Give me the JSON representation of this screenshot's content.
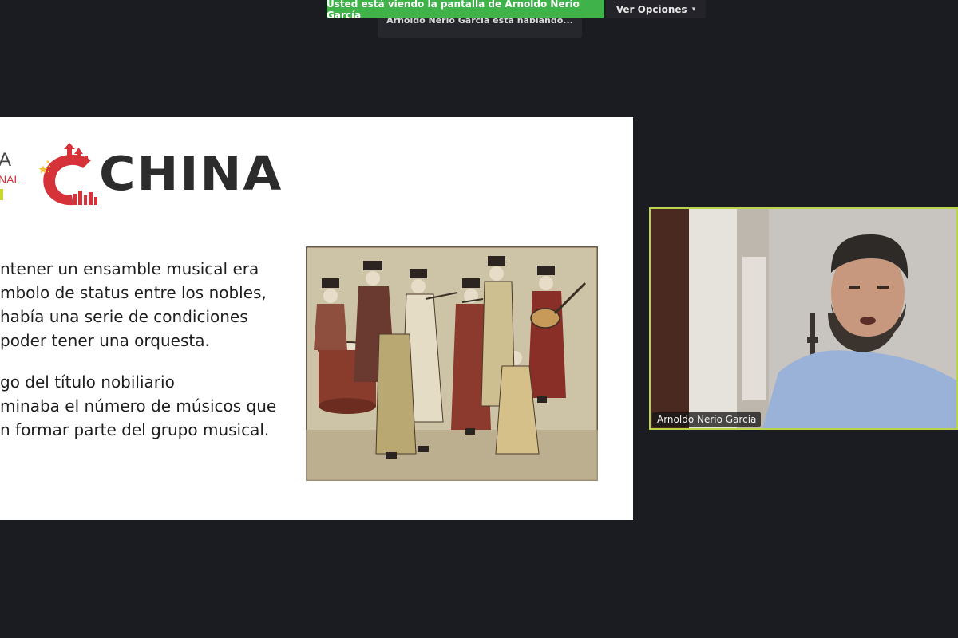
{
  "meeting": {
    "share_banner": "Usted está viendo la pantalla de Arnoldo Nerio García",
    "view_options_label": "Ver Opciones",
    "speaking_status": "Arnoldo Nerio García está hablando..."
  },
  "slide": {
    "brand_left_a": "A",
    "brand_left_nal": "NAL",
    "logo_word": "CHINA",
    "paragraphs": [
      {
        "lines": [
          "ntener un ensamble musical era",
          "mbolo de status entre los nobles,",
          "había una serie de condiciones",
          "poder tener una orquesta."
        ]
      },
      {
        "lines": [
          "go del título nobiliario",
          "minaba el número de músicos que",
          "n formar parte del grupo musical."
        ]
      }
    ],
    "painting_icon": "musicians-painting-image"
  },
  "video": {
    "participant_name": "Arnoldo Nerio García",
    "active_speaker_color": "#b9d34a"
  },
  "colors": {
    "banner_green": "#3fb24a",
    "background": "#1b1c22",
    "logo_red": "#d6323a"
  }
}
